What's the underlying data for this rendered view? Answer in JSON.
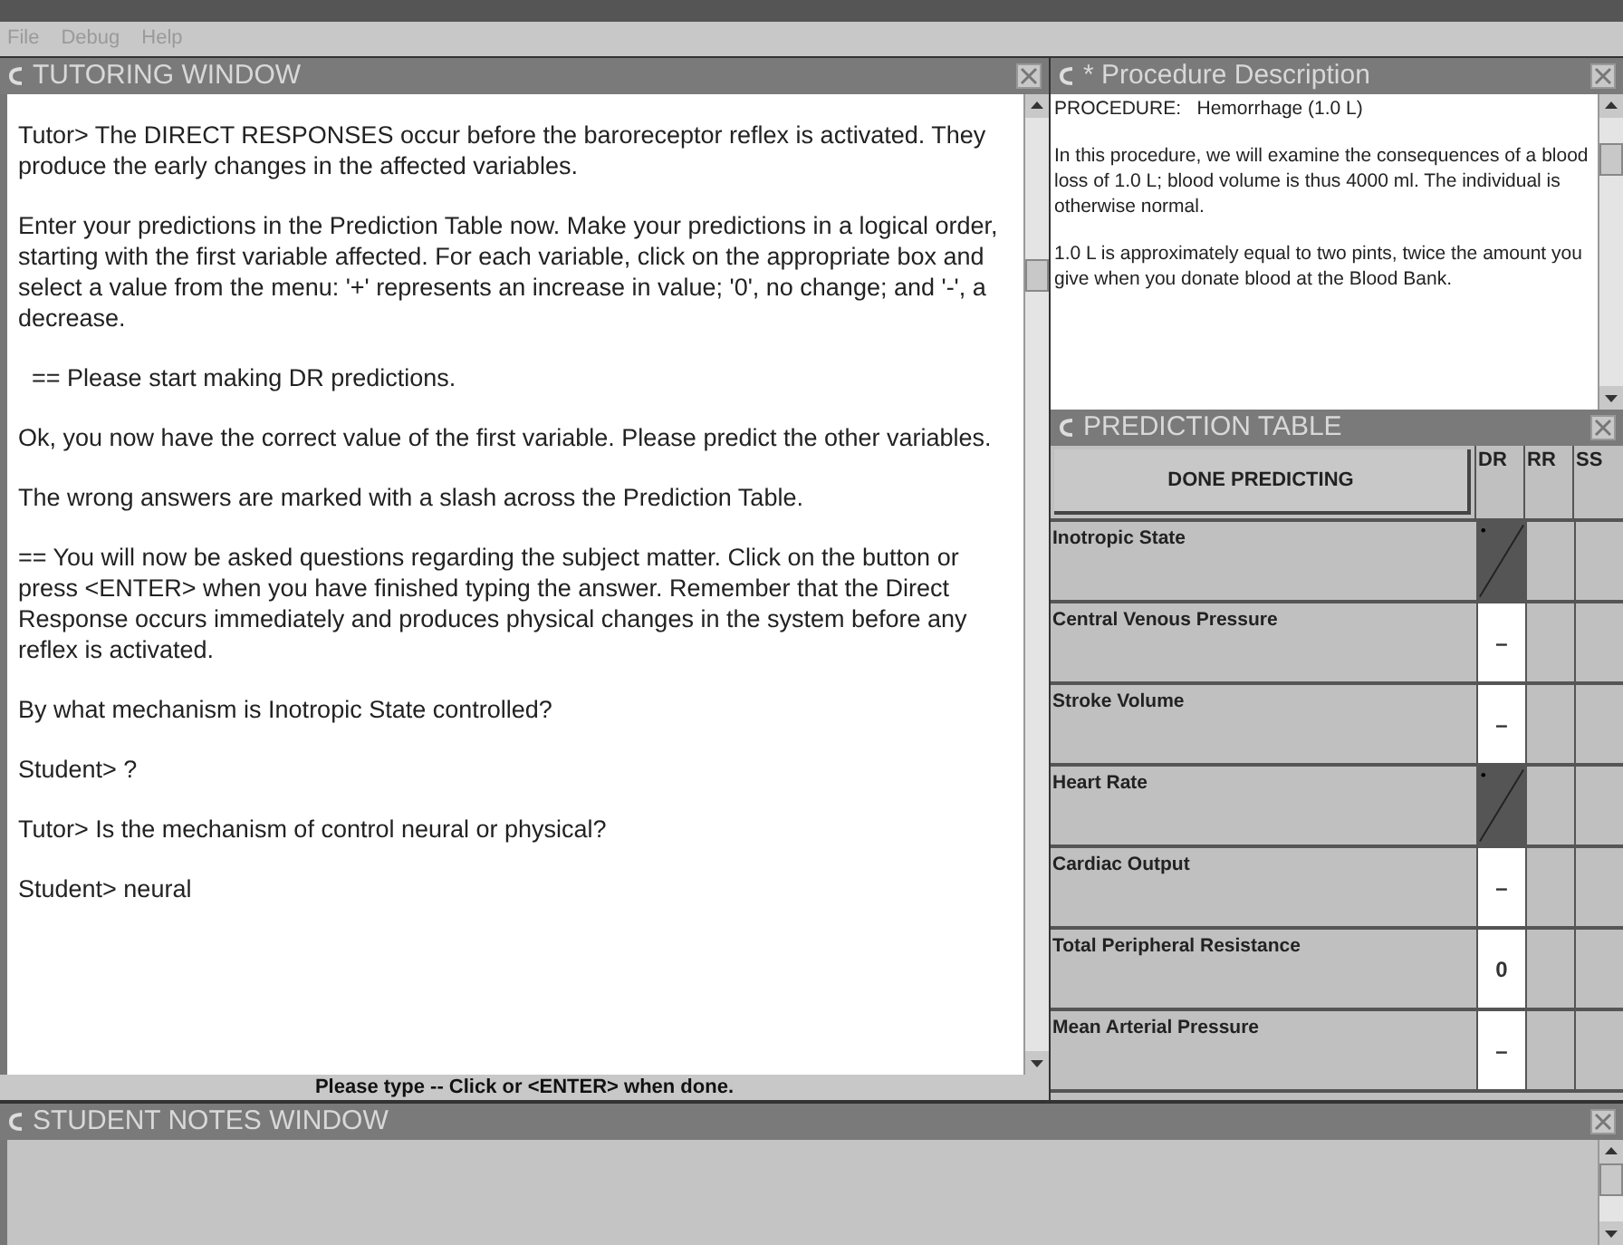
{
  "menu": [
    "File",
    "Debug",
    "Help"
  ],
  "tutoring_window": {
    "title": "TUTORING WINDOW",
    "messages": [
      "Tutor> The DIRECT RESPONSES occur before the baroreceptor reflex is activated. They produce the early changes in the affected variables.",
      "Enter your predictions in the Prediction Table now. Make your predictions in a logical order, starting with the first variable affected. For each variable, click on the appropriate box and select a value from the menu: '+' represents an increase in value; '0', no change; and '-', a decrease.",
      "  == Please start making DR predictions.",
      "Ok, you now have the correct value of the first variable. Please predict the other variables.",
      "The wrong answers are marked with a slash across the Prediction Table.",
      "== You will now be asked questions regarding the subject matter. Click on the button or press <ENTER> when you have finished typing the answer. Remember that the Direct Response occurs immediately and produces physical changes in the system before any reflex is activated.",
      "By what mechanism is Inotropic State controlled?",
      "Student> ?",
      "Tutor> Is the mechanism of control neural or physical?",
      "Student> neural"
    ],
    "status": "Please type -- Click or <ENTER> when done."
  },
  "procedure_window": {
    "title": "* Procedure Description",
    "paragraphs": [
      "PROCEDURE:   Hemorrhage (1.0 L)",
      "In this procedure, we will examine the consequences of a blood loss of 1.0 L; blood volume is thus 4000 ml. The individual is otherwise normal.",
      "1.0 L is approximately equal to two pints, twice the amount you give when you donate blood at the Blood Bank."
    ]
  },
  "prediction_table": {
    "title": "PREDICTION TABLE",
    "button": "DONE PREDICTING",
    "columns": [
      "DR",
      "RR",
      "SS"
    ],
    "rows": [
      {
        "variable": "Inotropic State",
        "dr": "",
        "wrong": true
      },
      {
        "variable": "Central Venous Pressure",
        "dr": "–",
        "wrong": false
      },
      {
        "variable": "Stroke Volume",
        "dr": "–",
        "wrong": false
      },
      {
        "variable": "Heart Rate",
        "dr": "",
        "wrong": true
      },
      {
        "variable": "Cardiac Output",
        "dr": "–",
        "wrong": false
      },
      {
        "variable": "Total Peripheral Resistance",
        "dr": "0",
        "wrong": false
      },
      {
        "variable": "Mean Arterial Pressure",
        "dr": "–",
        "wrong": false
      }
    ]
  },
  "notes_window": {
    "title": "STUDENT NOTES WINDOW"
  }
}
